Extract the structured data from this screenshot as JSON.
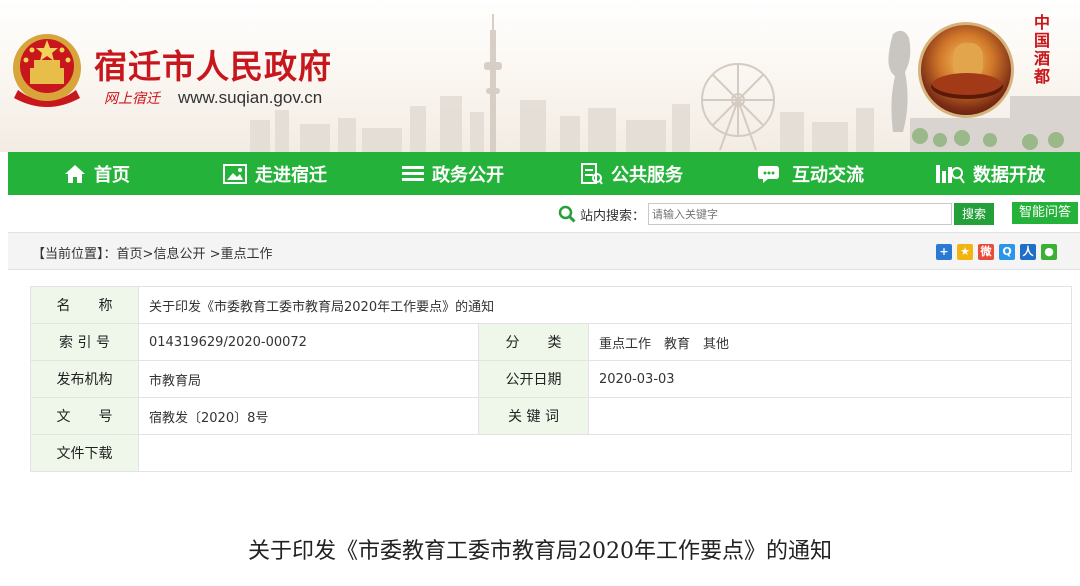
{
  "header": {
    "site_name": "宿迁市人民政府",
    "site_sub": "网上宿迁",
    "site_url": "www.suqian.gov.cn",
    "slogan": "中国酒都",
    "colors": {
      "brand_red": "#c8161d",
      "nav_green": "#24b23a"
    }
  },
  "nav": {
    "items": [
      {
        "label": "首页",
        "icon": "home-icon"
      },
      {
        "label": "走进宿迁",
        "icon": "picture-icon"
      },
      {
        "label": "政务公开",
        "icon": "list-icon"
      },
      {
        "label": "公共服务",
        "icon": "service-icon"
      },
      {
        "label": "互动交流",
        "icon": "chat-icon"
      },
      {
        "label": "数据开放",
        "icon": "data-icon"
      }
    ]
  },
  "search": {
    "label": "站内搜索：",
    "placeholder": "请输入关键字",
    "button": "搜索",
    "qa_button": "智能问答"
  },
  "breadcrumb": {
    "prefix": "【当前位置】：",
    "items": [
      "首页",
      "信息公开",
      "重点工作"
    ],
    "sep1": ">",
    "sep2": " >"
  },
  "share": [
    "plus-share-icon",
    "qzone-icon",
    "weibo-icon",
    "qq-icon",
    "renren-icon",
    "wechat-icon"
  ],
  "info": {
    "name_label": "名　　称",
    "name_value": "关于印发《市委教育工委市教育局2020年工作要点》的通知",
    "index_label": "索 引 号",
    "index_value": "014319629/2020-00072",
    "category_label": "分　　类",
    "category_value": "重点工作　教育　其他",
    "publisher_label": "发布机构",
    "publisher_value": "市教育局",
    "date_label": "公开日期",
    "date_value": "2020-03-03",
    "docno_label": "文　　号",
    "docno_value": "宿教发〔2020〕8号",
    "keywords_label": "关 键 词",
    "keywords_value": "",
    "download_label": "文件下载",
    "download_value": ""
  },
  "article": {
    "title": "关于印发《市委教育工委市教育局2020年工作要点》的通知"
  }
}
